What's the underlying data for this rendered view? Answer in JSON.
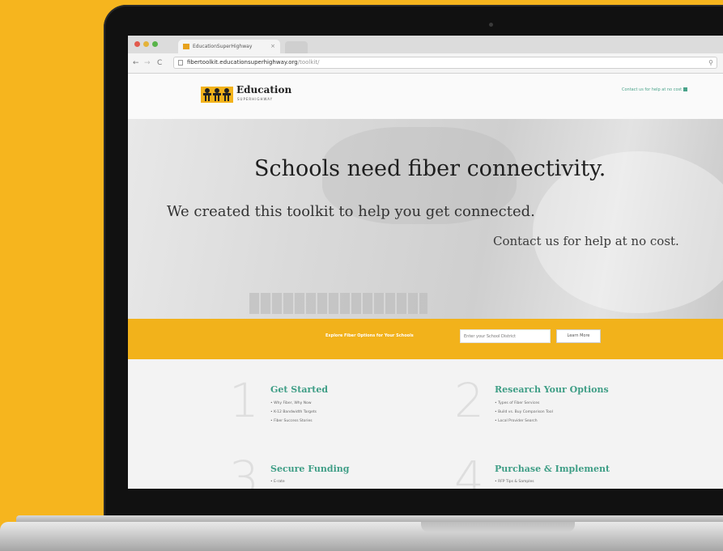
{
  "browser": {
    "tab_title": "EducationSuperHighway",
    "tab_close": "×",
    "url_host": "fibertoolkit.educationsuperhighway.org",
    "url_path": "/toolkit/",
    "nav_back": "←",
    "nav_forward": "→",
    "nav_reload": "C",
    "search_icon_glyph": "⚲"
  },
  "header": {
    "logo_text": "Education",
    "logo_subtext": "SUPERHIGHWAY",
    "contact_link": "Contact us for help at no cost"
  },
  "hero": {
    "title": "Schools need fiber connectivity.",
    "subtitle": "We created this toolkit to help you get connected.",
    "contact": "Contact us for help at no cost."
  },
  "search_band": {
    "label": "Explore Fiber Options for Your Schools",
    "input_placeholder": "Enter your School District",
    "button_label": "Learn More"
  },
  "steps": [
    {
      "number": "1",
      "title": "Get Started",
      "items": [
        "Why Fiber, Why Now",
        "K-12 Bandwidth Targets",
        "Fiber Success Stories"
      ]
    },
    {
      "number": "2",
      "title": "Research Your Options",
      "items": [
        "Types of Fiber Services",
        "Build vs. Buy Comparison Tool",
        "Local Provider Search"
      ]
    },
    {
      "number": "3",
      "title": "Secure Funding",
      "items": [
        "E-rate"
      ]
    },
    {
      "number": "4",
      "title": "Purchase & Implement",
      "items": [
        "RFP Tips & Samples"
      ]
    }
  ],
  "colors": {
    "background": "#F6B51E",
    "accent_teal": "#3f9e86",
    "band_orange": "#F2B21B"
  }
}
